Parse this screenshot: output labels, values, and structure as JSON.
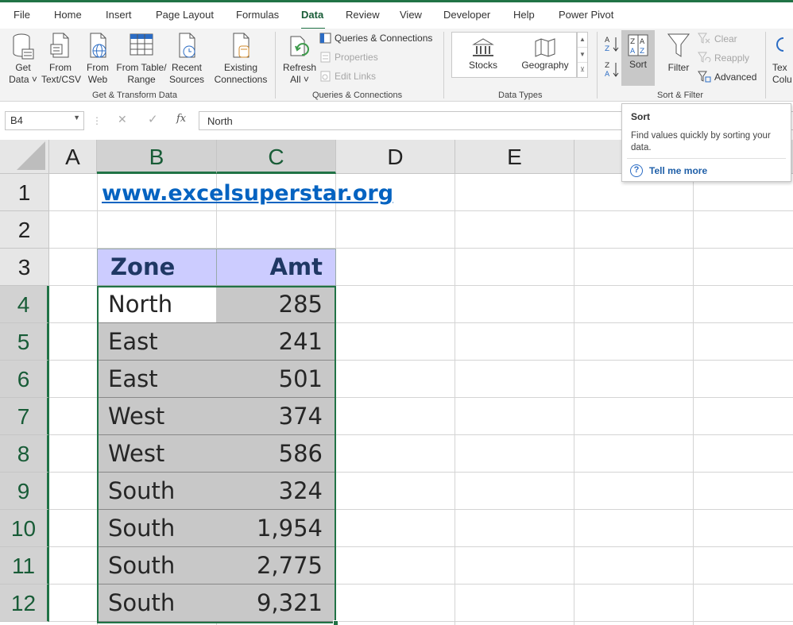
{
  "menu": {
    "tabs": [
      "File",
      "Home",
      "Insert",
      "Page Layout",
      "Formulas",
      "Data",
      "Review",
      "View",
      "Developer",
      "Help",
      "Power Pivot"
    ],
    "active": "Data"
  },
  "ribbon": {
    "get_transform": {
      "get_data": [
        "Get",
        "Data ˅"
      ],
      "from_text_csv": [
        "From",
        "Text/CSV"
      ],
      "from_web": [
        "From",
        "Web"
      ],
      "from_table_range": [
        "From Table/",
        "Range"
      ],
      "recent_sources": [
        "Recent",
        "Sources"
      ],
      "existing_connections": [
        "Existing",
        "Connections"
      ],
      "label": "Get & Transform Data"
    },
    "queries": {
      "refresh_all": [
        "Refresh",
        "All ˅"
      ],
      "queries_connections": "Queries & Connections",
      "properties": "Properties",
      "edit_links": "Edit Links",
      "label": "Queries & Connections"
    },
    "data_types": {
      "stocks": "Stocks",
      "geography": "Geography",
      "label": "Data Types"
    },
    "sort_filter": {
      "sort": "Sort",
      "filter": "Filter",
      "clear": "Clear",
      "reapply": "Reapply",
      "advanced": "Advanced",
      "label": "Sort & Filter"
    },
    "text_columns": [
      "Tex",
      "Colu"
    ]
  },
  "formula_bar": {
    "name_box": "B4",
    "fx": "fx",
    "value": "North"
  },
  "tooltip": {
    "title": "Sort",
    "description": "Find values quickly by sorting your data.",
    "tell_me_more": "Tell me more"
  },
  "sheet": {
    "columns": [
      "A",
      "B",
      "C",
      "D",
      "E"
    ],
    "rows": [
      "1",
      "2",
      "3",
      "4",
      "5",
      "6",
      "7",
      "8",
      "9",
      "10",
      "11",
      "12"
    ],
    "link": "www.excelsuperstar.org",
    "headers": {
      "zone": "Zone",
      "amt": "Amt"
    },
    "data": [
      {
        "zone": "North",
        "amt": "285"
      },
      {
        "zone": "East",
        "amt": "241"
      },
      {
        "zone": "East",
        "amt": "501"
      },
      {
        "zone": "West",
        "amt": "374"
      },
      {
        "zone": "West",
        "amt": "586"
      },
      {
        "zone": "South",
        "amt": "324"
      },
      {
        "zone": "South",
        "amt": "1,954"
      },
      {
        "zone": "South",
        "amt": "2,775"
      },
      {
        "zone": "South",
        "amt": "9,321"
      }
    ]
  },
  "colors": {
    "excel_green": "#217346",
    "header_fill": "#ccccff",
    "selection_fill": "#c8c8c8",
    "link": "#0563c1"
  }
}
